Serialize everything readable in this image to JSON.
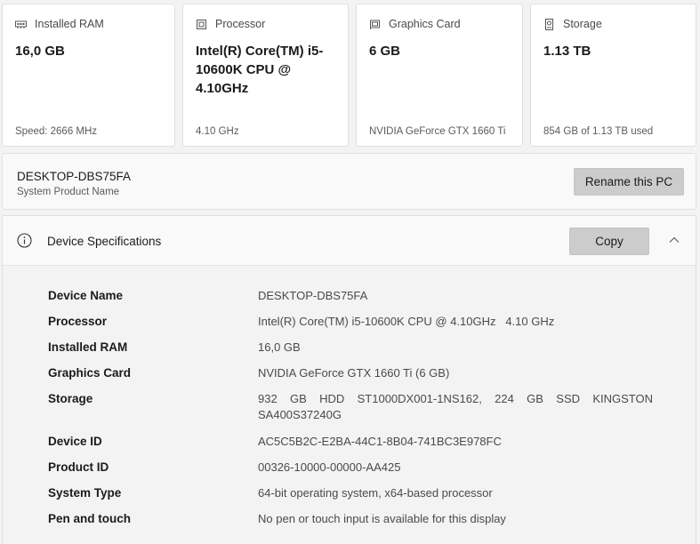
{
  "cards": [
    {
      "icon": "ram-icon",
      "title": "Installed RAM",
      "value": "16,0 GB",
      "foot": "Speed: 2666 MHz"
    },
    {
      "icon": "processor-icon",
      "title": "Processor",
      "value": "Intel(R) Core(TM) i5-10600K CPU @ 4.10GHz",
      "foot": "4.10 GHz"
    },
    {
      "icon": "graphics-card-icon",
      "title": "Graphics Card",
      "value": "6 GB",
      "foot": "NVIDIA GeForce GTX 1660 Ti"
    },
    {
      "icon": "storage-icon",
      "title": "Storage",
      "value": "1.13 TB",
      "foot": "854 GB of 1.13 TB used"
    }
  ],
  "pc": {
    "name": "DESKTOP-DBS75FA",
    "subtitle": "System Product Name",
    "rename_label": "Rename this PC"
  },
  "specs": {
    "title": "Device Specifications",
    "copy_label": "Copy",
    "rows": [
      {
        "label": "Device Name",
        "value": "DESKTOP-DBS75FA"
      },
      {
        "label": "Processor",
        "value": "Intel(R) Core(TM) i5-10600K CPU @ 4.10GHz   4.10 GHz"
      },
      {
        "label": "Installed RAM",
        "value": "16,0 GB"
      },
      {
        "label": "Graphics Card",
        "value": "NVIDIA GeForce GTX 1660 Ti (6 GB)"
      },
      {
        "label": "Storage",
        "value": "932 GB HDD ST1000DX001-1NS162, 224 GB SSD KINGSTON SA400S37240G"
      },
      {
        "label": "Device ID",
        "value": "AC5C5B2C-E2BA-44C1-8B04-741BC3E978FC"
      },
      {
        "label": "Product ID",
        "value": "00326-10000-00000-AA425"
      },
      {
        "label": "System Type",
        "value": "64-bit operating system, x64-based processor"
      },
      {
        "label": "Pen and touch",
        "value": "No pen or touch input is available for this display"
      }
    ]
  },
  "colors": {
    "background": "#f3f3f3",
    "card": "#ffffff",
    "button": "#cccccc"
  }
}
